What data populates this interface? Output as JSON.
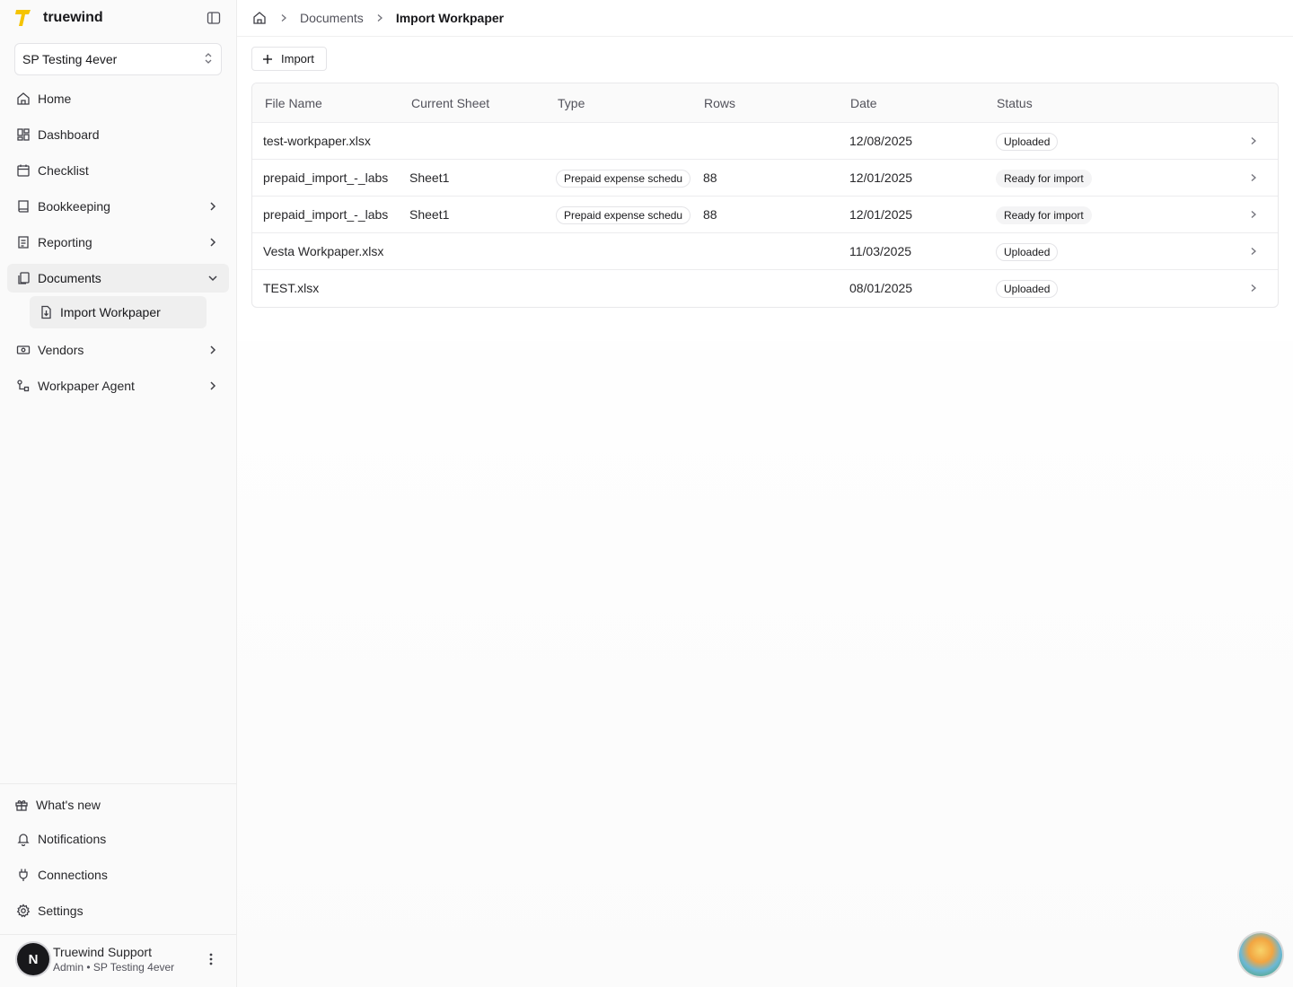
{
  "brand": {
    "name": "truewind"
  },
  "workspace": {
    "name": "SP Testing 4ever"
  },
  "nav": {
    "home": "Home",
    "dashboard": "Dashboard",
    "checklist": "Checklist",
    "bookkeeping": "Bookkeeping",
    "reporting": "Reporting",
    "documents": "Documents",
    "import_workpaper": "Import Workpaper",
    "vendors": "Vendors",
    "workpaper_agent": "Workpaper Agent"
  },
  "footer_nav": {
    "whats_new": "What's new",
    "notifications": "Notifications",
    "connections": "Connections",
    "settings": "Settings"
  },
  "user": {
    "initial": "N",
    "name": "Truewind Support",
    "role": "Admin • SP Testing 4ever"
  },
  "breadcrumb": {
    "parent": "Documents",
    "current": "Import Workpaper"
  },
  "toolbar": {
    "import_label": "Import"
  },
  "table": {
    "headers": [
      "File Name",
      "Current Sheet",
      "Type",
      "Rows",
      "Date",
      "Status"
    ],
    "rows": [
      {
        "file": "test-workpaper.xlsx",
        "sheet": "",
        "type": "",
        "rows": "",
        "date": "12/08/2025",
        "status": "Uploaded",
        "status_kind": "uploaded"
      },
      {
        "file": "prepaid_import_-_labs",
        "sheet": "Sheet1",
        "type": "Prepaid expense schedu",
        "rows": "88",
        "date": "12/01/2025",
        "status": "Ready for import",
        "status_kind": "ready"
      },
      {
        "file": "prepaid_import_-_labs",
        "sheet": "Sheet1",
        "type": "Prepaid expense schedu",
        "rows": "88",
        "date": "12/01/2025",
        "status": "Ready for import",
        "status_kind": "ready"
      },
      {
        "file": "Vesta Workpaper.xlsx",
        "sheet": "",
        "type": "",
        "rows": "",
        "date": "11/03/2025",
        "status": "Uploaded",
        "status_kind": "uploaded"
      },
      {
        "file": "TEST.xlsx",
        "sheet": "",
        "type": "",
        "rows": "",
        "date": "08/01/2025",
        "status": "Uploaded",
        "status_kind": "uploaded"
      }
    ]
  },
  "colors": {
    "brand_yellow": "#f5c400",
    "text": "#18181b",
    "muted": "#52525b",
    "border": "#e4e4e7"
  }
}
